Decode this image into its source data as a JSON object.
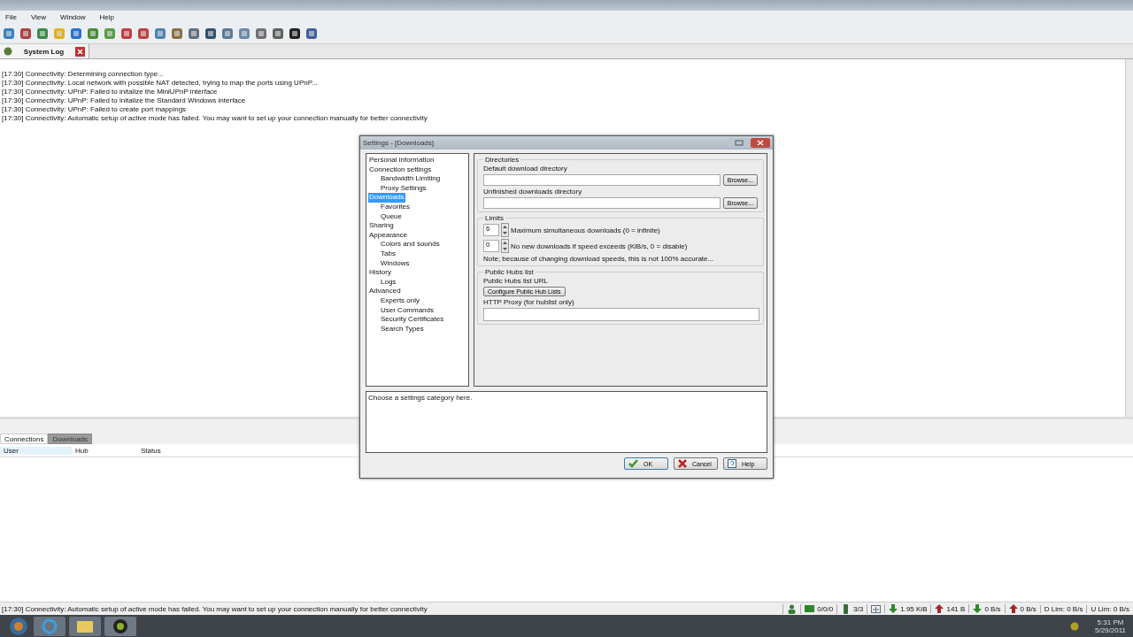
{
  "menu": [
    "File",
    "View",
    "Window",
    "Help"
  ],
  "log_tab": {
    "label": "System Log"
  },
  "log_lines": [
    "[17:30] Connectivity: Determining connection type...",
    "[17:30] Connectivity: Local network with possible NAT detected, trying to map the ports using UPnP...",
    "[17:30] Connectivity: UPnP: Failed to initalize the MiniUPnP interface",
    "[17:30] Connectivity: UPnP: Failed to initalize the Standard Windows interface",
    "[17:30] Connectivity: UPnP: Failed to create port mappings",
    "[17:30] Connectivity: Automatic setup of active mode has failed. You may want to set up your connection manually for better connectivity"
  ],
  "dialog": {
    "title": "Settings - [Downloads]",
    "tree": [
      {
        "label": "Personal information",
        "selected": false
      },
      {
        "label": "Connection settings",
        "selected": false,
        "children": [
          {
            "label": "Bandwidth Limiting",
            "selected": false
          },
          {
            "label": "Proxy Settings",
            "selected": false
          }
        ]
      },
      {
        "label": "Downloads",
        "selected": true,
        "children": [
          {
            "label": "Favorites",
            "selected": false
          },
          {
            "label": "Queue",
            "selected": false
          }
        ]
      },
      {
        "label": "Sharing",
        "selected": false
      },
      {
        "label": "Appearance",
        "selected": false,
        "children": [
          {
            "label": "Colors and sounds",
            "selected": false
          },
          {
            "label": "Tabs",
            "selected": false
          },
          {
            "label": "Windows",
            "selected": false
          }
        ]
      },
      {
        "label": "History",
        "selected": false,
        "children": [
          {
            "label": "Logs",
            "selected": false
          }
        ]
      },
      {
        "label": "Advanced",
        "selected": false,
        "children": [
          {
            "label": "Experts only",
            "selected": false
          },
          {
            "label": "User Commands",
            "selected": false
          },
          {
            "label": "Security Certificates",
            "selected": false
          },
          {
            "label": "Search Types",
            "selected": false
          }
        ]
      }
    ],
    "directories": {
      "legend": "Directories",
      "fields": [
        {
          "label": "Default download directory",
          "button": "Browse..."
        },
        {
          "label": "Unfinished downloads directory",
          "button": "Browse..."
        }
      ]
    },
    "limits": {
      "legend": "Limits",
      "spinners": [
        {
          "value": "6",
          "label": "Maximum simultaneous downloads (0 = infinite)"
        },
        {
          "value": "0",
          "label": "No new downloads if speed exceeds (KiB/s, 0 = disable)"
        }
      ],
      "note": "Note; because of changing download speeds, this is not 100% accurate..."
    },
    "hubs": {
      "legend": "Public Hubs list",
      "url_label": "Public Hubs list URL",
      "button": "Configure Public Hub Lists",
      "proxy_label": "HTTP Proxy (for hublist only)"
    },
    "description": "Choose a settings category here.",
    "buttons": [
      {
        "kind": "ok",
        "label": "OK"
      },
      {
        "kind": "cancel",
        "label": "Cancel"
      },
      {
        "kind": "help",
        "label": "Help"
      }
    ]
  },
  "lower_tabs": [
    {
      "label": "Connections",
      "selected": true
    },
    {
      "label": "Downloads",
      "selected": false
    }
  ],
  "columns": [
    "User",
    "Hub",
    "Status"
  ],
  "status_message": "[17:30] Connectivity: Automatic setup of active mode has failed. You may want to set up your connection manually for better connectivity",
  "status_items": [
    {
      "kind": "user"
    },
    {
      "kind": "screen",
      "text": "0/0/0"
    },
    {
      "kind": "light",
      "text": "3/3"
    },
    {
      "kind": "net"
    },
    {
      "kind": "down",
      "text": "1.95 KiB"
    },
    {
      "kind": "up",
      "text": "141 B"
    },
    {
      "kind": "down",
      "text": "0 B/s"
    },
    {
      "kind": "up",
      "text": "0 B/s"
    },
    {
      "text": "D Lim: 0 B/s"
    },
    {
      "text": "U Lim: 0 B/s"
    }
  ],
  "clock": {
    "time": "5:31 PM",
    "date": "5/29/2011"
  }
}
